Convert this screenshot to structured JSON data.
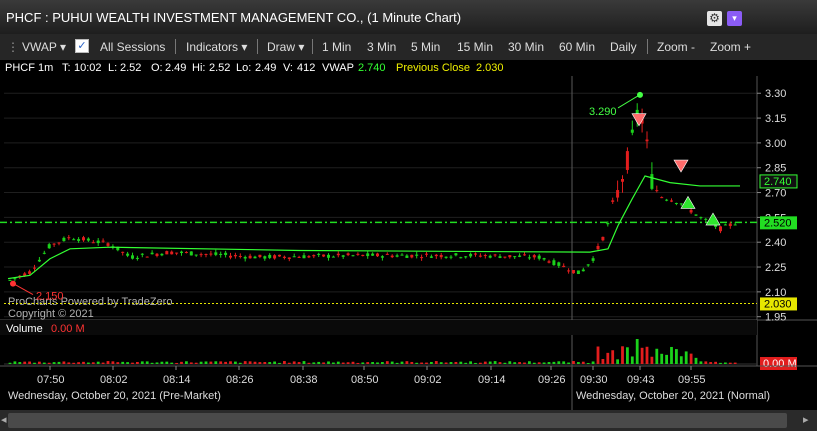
{
  "window": {
    "title": "PHCF : PUHUI WEALTH INVESTMENT MANAGEMENT CO., (1 Minute Chart)"
  },
  "toolbar": {
    "vwap_label": "VWAP ▾",
    "all_sessions_label": "All Sessions",
    "indicators_label": "Indicators ▾",
    "draw_label": "Draw ▾",
    "intervals": [
      "1 Min",
      "3 Min",
      "5 Min",
      "15 Min",
      "30 Min",
      "60 Min",
      "Daily"
    ],
    "zoom_out_label": "Zoom -",
    "zoom_in_label": "Zoom +"
  },
  "info": {
    "symbol": "PHCF 1m",
    "t_label": "T:",
    "t_value": "10:02",
    "l_label": "L:",
    "l_value": "2.52",
    "o_label": "O:",
    "o_value": "2.49",
    "hi_label": "Hi:",
    "hi_value": "2.52",
    "lo_label": "Lo:",
    "lo_value": "2.49",
    "v_label": "V:",
    "v_value": "412",
    "vwap_label": "VWAP",
    "vwap_value": "2.740",
    "prev_close_label": "Previous Close",
    "prev_close_value": "2.030"
  },
  "chart_data": {
    "type": "candlestick",
    "price_ticks": [
      "3.30",
      "3.15",
      "3.00",
      "2.85",
      "2.70",
      "2.55",
      "2.40",
      "2.25",
      "2.10",
      "1.95"
    ],
    "y_range": [
      1.93,
      3.38
    ],
    "time_ticks": [
      "07:50",
      "08:02",
      "08:14",
      "08:26",
      "08:38",
      "08:50",
      "09:02",
      "09:14",
      "09:26",
      "09:30",
      "09:43",
      "09:55"
    ],
    "vwap_badge": "2.740",
    "last_price_badge": "2.520",
    "prev_close_badge": "2.030",
    "high_marker": "3.290",
    "low_marker": "2.150",
    "watermark_lines": [
      "ProCharts Powered by TradeZero",
      "Copyright © 2021"
    ],
    "volume_label": "Volume",
    "volume_value": "0.00 M",
    "volume_badge": "0.00 M",
    "date_left": "Wednesday, October 20, 2021 (Pre-Market)",
    "date_right": "Wednesday, October 20, 2021 (Normal)",
    "colors": {
      "up": "#1bd11b",
      "down": "#e21d1d",
      "vwap": "#33ff33",
      "last_price": "#22dd22",
      "prev_close": "#e6e600",
      "session_divider": "#5a5a5a"
    }
  }
}
